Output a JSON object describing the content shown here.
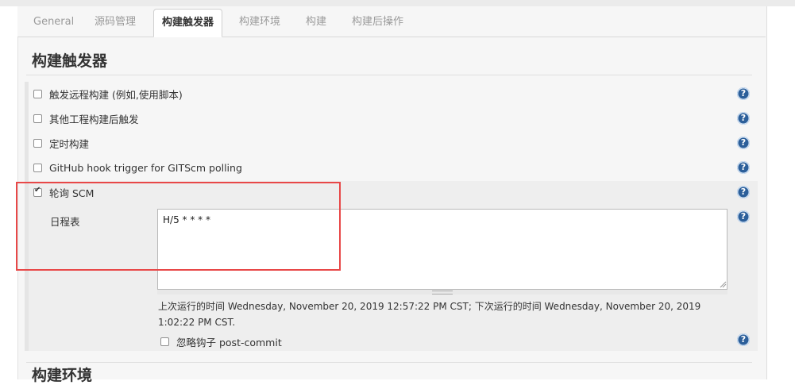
{
  "tabs": [
    {
      "label": "General"
    },
    {
      "label": "源码管理"
    },
    {
      "label": "构建触发器"
    },
    {
      "label": "构建环境"
    },
    {
      "label": "构建"
    },
    {
      "label": "构建后操作"
    }
  ],
  "section": {
    "title": "构建触发器"
  },
  "options": [
    {
      "label": "触发远程构建 (例如,使用脚本)",
      "checked": false
    },
    {
      "label": "其他工程构建后触发",
      "checked": false
    },
    {
      "label": "定时构建",
      "checked": false
    },
    {
      "label": "GitHub hook trigger for GITScm polling",
      "checked": false
    },
    {
      "label": "轮询 SCM",
      "checked": true
    }
  ],
  "schedule": {
    "label": "日程表",
    "value": "H/5 * * * *",
    "info": "上次运行的时间 Wednesday, November 20, 2019 12:57:22 PM CST; 下次运行的时间 Wednesday, November 20, 2019 1:02:22 PM CST.",
    "ignore_hooks_label": "忽略钩子 post-commit",
    "ignore_hooks_checked": false
  },
  "help_glyph": "?",
  "next_section": {
    "title": "构建环境"
  },
  "colors": {
    "accent": "#2c5f9a",
    "highlight_box": "#e84848"
  }
}
